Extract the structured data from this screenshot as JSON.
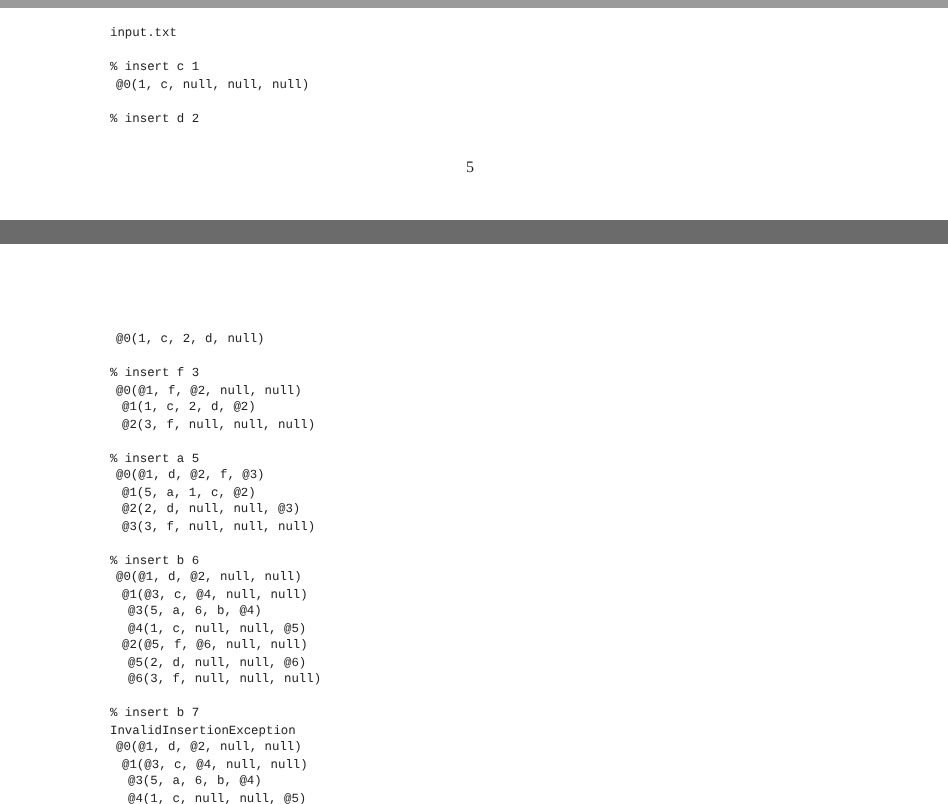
{
  "pages": [
    {
      "blocks": [
        {
          "kind": "filename",
          "text": "input.txt"
        },
        {
          "kind": "insert",
          "command": "% insert c 1",
          "nodes": [
            {
              "text": "@0(1, c, null, null, null)"
            }
          ]
        },
        {
          "kind": "insert",
          "command": "% insert d 2"
        }
      ],
      "page_number": "5"
    },
    {
      "blocks": [
        {
          "kind": "continuation",
          "nodes": [
            {
              "text": "@0(1, c, 2, d, null)"
            }
          ]
        },
        {
          "kind": "insert",
          "command": "% insert f 3",
          "nodes": [
            {
              "text": "@0(@1, f, @2, null, null)",
              "children": [
                {
                  "text": "@1(1, c, 2, d, @2)"
                },
                {
                  "text": "@2(3, f, null, null, null)"
                }
              ]
            }
          ]
        },
        {
          "kind": "insert",
          "command": "% insert a 5",
          "nodes": [
            {
              "text": "@0(@1, d, @2, f, @3)",
              "children": [
                {
                  "text": "@1(5, a, 1, c, @2)"
                },
                {
                  "text": "@2(2, d, null, null, @3)"
                },
                {
                  "text": "@3(3, f, null, null, null)"
                }
              ]
            }
          ]
        },
        {
          "kind": "insert",
          "command": "% insert b 6",
          "nodes": [
            {
              "text": "@0(@1, d, @2, null, null)",
              "children": [
                {
                  "text": "@1(@3, c, @4, null, null)",
                  "children": [
                    {
                      "text": "@3(5, a, 6, b, @4)"
                    },
                    {
                      "text": "@4(1, c, null, null, @5)"
                    }
                  ]
                },
                {
                  "text": "@2(@5, f, @6, null, null)",
                  "children": [
                    {
                      "text": "@5(2, d, null, null, @6)"
                    },
                    {
                      "text": "@6(3, f, null, null, null)"
                    }
                  ]
                }
              ]
            }
          ]
        },
        {
          "kind": "insert",
          "command": "% insert b 7",
          "message": "InvalidInsertionException",
          "nodes": [
            {
              "text": "@0(@1, d, @2, null, null)",
              "children": [
                {
                  "text": "@1(@3, c, @4, null, null)",
                  "children": [
                    {
                      "text": "@3(5, a, 6, b, @4)"
                    },
                    {
                      "text": "@4(1, c, null, null, @5)"
                    }
                  ]
                }
              ]
            }
          ]
        }
      ]
    }
  ]
}
